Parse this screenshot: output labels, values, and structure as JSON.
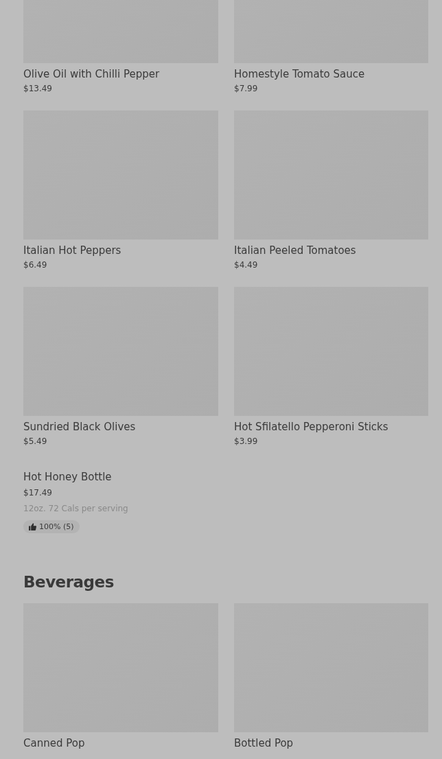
{
  "sections": [
    {
      "items": [
        {
          "kind": "photo",
          "name": "Olive Oil with Chilli Pepper",
          "price": "$13.49"
        },
        {
          "kind": "photo",
          "name": "Homestyle Tomato Sauce",
          "price": "$7.99"
        },
        {
          "kind": "photo",
          "name": "Italian Hot Peppers",
          "price": "$6.49"
        },
        {
          "kind": "photo",
          "name": "Italian Peeled Tomatoes",
          "price": "$4.49"
        },
        {
          "kind": "photo",
          "name": "Sundried Black Olives",
          "price": "$5.49"
        },
        {
          "kind": "photo",
          "name": "Hot Sfilatello Pepperoni Sticks",
          "price": "$3.99"
        },
        {
          "kind": "plain",
          "name": "Hot Honey Bottle",
          "price": "$17.49",
          "description": "12oz. 72 Cals per serving",
          "rating": "100% (5)"
        }
      ]
    },
    {
      "title": "Beverages",
      "items": [
        {
          "kind": "photo",
          "name": "Canned Pop"
        },
        {
          "kind": "photo",
          "name": "Bottled Pop"
        }
      ]
    }
  ]
}
